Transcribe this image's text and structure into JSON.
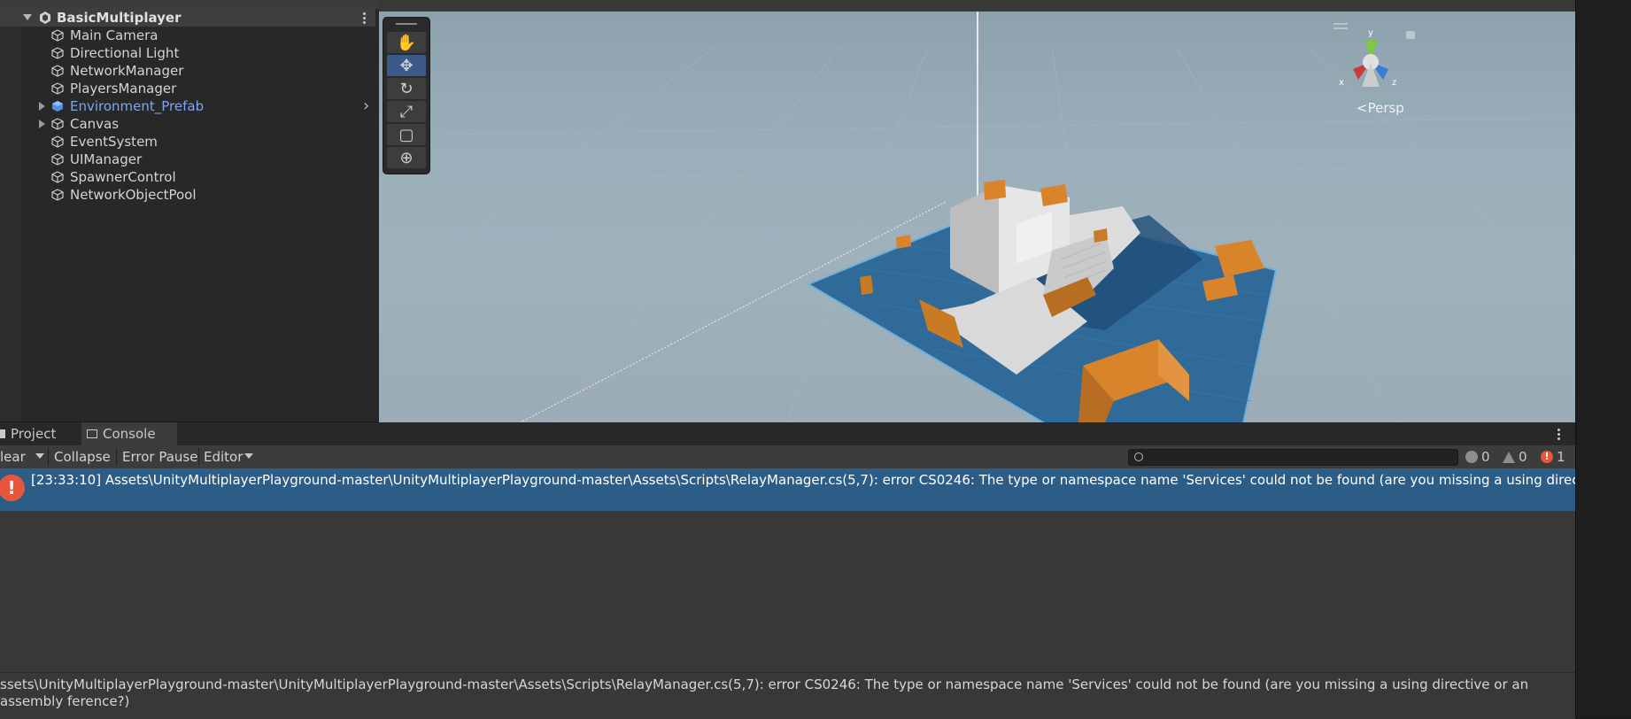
{
  "hierarchy": {
    "scene_name": "BasicMultiplayer",
    "items": [
      {
        "label": "Main Camera",
        "has_children": false,
        "prefab": false
      },
      {
        "label": "Directional Light",
        "has_children": false,
        "prefab": false
      },
      {
        "label": "NetworkManager",
        "has_children": false,
        "prefab": false
      },
      {
        "label": "PlayersManager",
        "has_children": false,
        "prefab": false
      },
      {
        "label": "Environment_Prefab",
        "has_children": true,
        "prefab": true
      },
      {
        "label": "Canvas",
        "has_children": true,
        "prefab": false
      },
      {
        "label": "EventSystem",
        "has_children": false,
        "prefab": false
      },
      {
        "label": "UIManager",
        "has_children": false,
        "prefab": false
      },
      {
        "label": "SpawnerControl",
        "has_children": false,
        "prefab": false
      },
      {
        "label": "NetworkObjectPool",
        "has_children": false,
        "prefab": false
      }
    ]
  },
  "scene_view": {
    "projection_label": "Persp",
    "gizmo_axes": {
      "x": "x",
      "y": "y",
      "z": "z"
    },
    "colors": {
      "ground": "#2f6a98",
      "building": "#d8d8d8",
      "crate": "#d9842a",
      "sky": "#9aafba"
    }
  },
  "tabs": {
    "project": "Project",
    "console": "Console"
  },
  "console_toolbar": {
    "clear": "lear",
    "collapse": "Collapse",
    "error_pause": "Error Pause",
    "editor": "Editor",
    "search_placeholder": "",
    "log_count": "0",
    "warning_count": "0",
    "error_count": "1"
  },
  "log_entries": [
    {
      "type": "error",
      "text": "[23:33:10] Assets\\UnityMultiplayerPlayground-master\\UnityMultiplayerPlayground-master\\Assets\\Scripts\\RelayManager.cs(5,7): error CS0246: The type or namespace name 'Services' could not be found (are you missing a using directive or an"
    }
  ],
  "detail": {
    "text": "ssets\\UnityMultiplayerPlayground-master\\UnityMultiplayerPlayground-master\\Assets\\Scripts\\RelayManager.cs(5,7): error CS0246: The type or namespace name 'Services' could not be found (are you missing a using directive or an assembly ference?)"
  },
  "colors": {
    "selection": "#2c5d87",
    "error": "#e8553d",
    "prefab_text": "#7fa5ef"
  }
}
